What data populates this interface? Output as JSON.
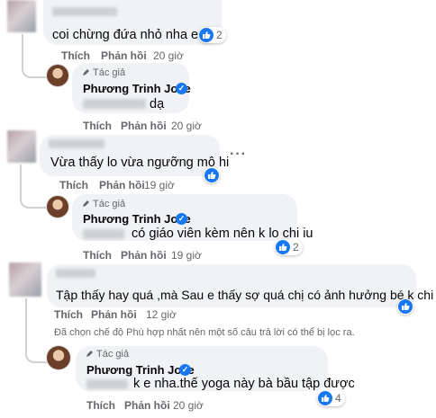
{
  "actions": {
    "like": "Thích",
    "reply": "Phản hồi"
  },
  "author_badge": "Tác giả",
  "author_name": "Phương Trinh Jolie",
  "comments": [
    {
      "text": "coi chừng đứa nhỏ nha em",
      "time": "20 giờ",
      "reactions": "2",
      "reply": {
        "text": "dạ",
        "time": "20 giờ"
      }
    },
    {
      "text": "Vừa thấy lo vừa ngưỡng mộ hi",
      "time": "19 giờ",
      "more": "···",
      "reply": {
        "text": "có giáo viên kèm nên k lo chi iu",
        "time": "19 giờ",
        "reactions": "2"
      }
    },
    {
      "text": "Tập thấy hay quá ,mà Sau e thấy sợ quá chị có ảnh hưởng bé k chi",
      "time": "12 giờ",
      "notice": "Đã chọn chế độ Phù hợp nhất nên một số câu trả lời có thể bị lọc ra.",
      "reply": {
        "text": "k e nha.thế yoga này bà bầu tập được",
        "time": "20 giờ",
        "reactions": "4"
      }
    }
  ],
  "colors": {
    "like_blue": "#1877f2",
    "bubble": "#f0f2f5",
    "muted": "#65676b"
  }
}
